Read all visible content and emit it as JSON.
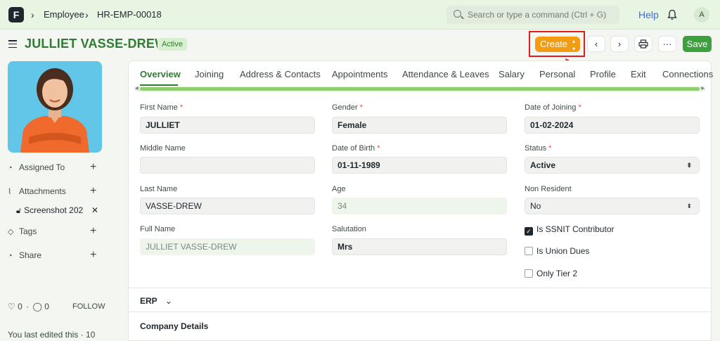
{
  "navbar": {
    "logo": "F",
    "breadcrumbs": [
      "Employee",
      "HR-EMP-00018"
    ],
    "search_placeholder": "Search or type a command (Ctrl + G)",
    "help": "Help",
    "user_initial": "A"
  },
  "header": {
    "title": "JULLIET VASSE-DREW",
    "status": "Active",
    "create_label": "Create",
    "save_label": "Save",
    "more_label": "···"
  },
  "sidebar": {
    "assigned_to": "Assigned To",
    "attachments": "Attachments",
    "attachment_file": "Screenshot 202",
    "tags": "Tags",
    "share": "Share",
    "likes": "0",
    "comments": "0",
    "follow": "FOLLOW",
    "last_edited": "You last edited this · 10"
  },
  "tabs": [
    "Overview",
    "Joining",
    "Address & Contacts",
    "Appointments",
    "Attendance & Leaves",
    "Salary",
    "Personal",
    "Profile",
    "Exit",
    "Connections"
  ],
  "form": {
    "first_name": {
      "label": "First Name",
      "value": "JULLIET"
    },
    "middle_name": {
      "label": "Middle Name",
      "value": ""
    },
    "last_name": {
      "label": "Last Name",
      "value": "VASSE-DREW"
    },
    "full_name": {
      "label": "Full Name",
      "value": "JULLIET VASSE-DREW"
    },
    "gender": {
      "label": "Gender",
      "value": "Female"
    },
    "date_of_birth": {
      "label": "Date of Birth",
      "value": "01-11-1989"
    },
    "age": {
      "label": "Age",
      "value": "34"
    },
    "salutation": {
      "label": "Salutation",
      "value": "Mrs"
    },
    "date_of_joining": {
      "label": "Date of Joining",
      "value": "01-02-2024"
    },
    "status": {
      "label": "Status",
      "value": "Active"
    },
    "non_resident": {
      "label": "Non Resident",
      "value": "No"
    },
    "is_ssnit": {
      "label": "Is SSNIT Contributor",
      "checked": true
    },
    "is_union_dues": {
      "label": "Is Union Dues",
      "checked": false
    },
    "only_tier2": {
      "label": "Only Tier 2",
      "checked": false
    }
  },
  "sections": {
    "erp": "ERP",
    "company_details": "Company Details"
  },
  "colors": {
    "accent": "#2e7d32",
    "create": "#f39c12",
    "save": "#3ca03c",
    "highlight": "#e41b1b"
  }
}
